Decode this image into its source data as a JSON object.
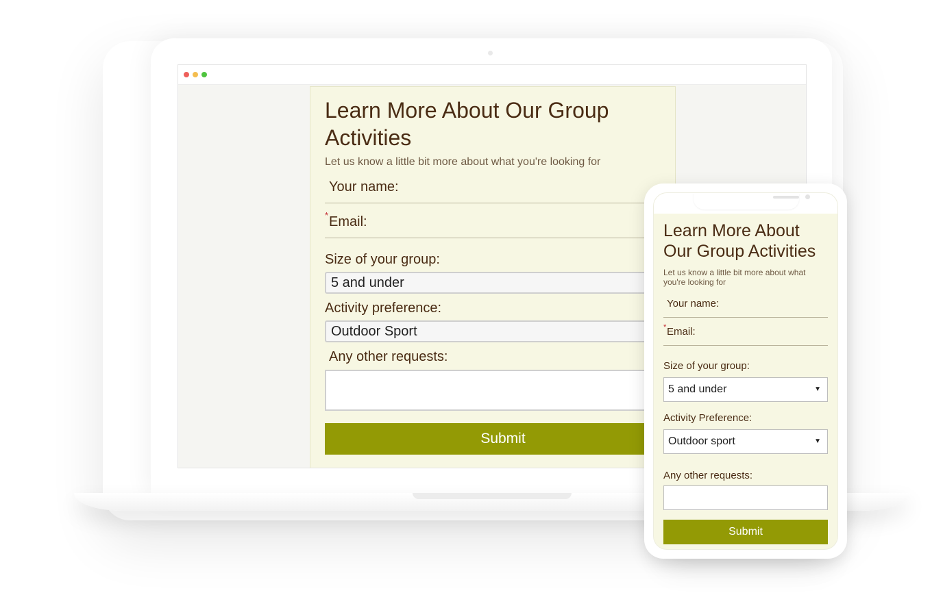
{
  "desktop": {
    "form": {
      "title": "Learn More About Our Group Activities",
      "subtitle": "Let us know a little bit more about what you're looking for",
      "name_label": "Your name:",
      "email_required_mark": "*",
      "email_label": "Email:",
      "group_size_label": "Size of your group:",
      "group_size_value": "5 and under",
      "activity_label": "Activity preference:",
      "activity_value": "Outdoor Sport",
      "requests_label": "Any other requests:",
      "requests_value": "",
      "submit_label": "Submit"
    }
  },
  "mobile": {
    "form": {
      "title": "Learn More About Our Group Activities",
      "subtitle": "Let us know a little bit more about what you're looking for",
      "name_label": "Your name:",
      "email_required_mark": "*",
      "email_label": "Email:",
      "group_size_label": "Size of your group:",
      "group_size_value": "5 and under",
      "activity_label": "Activity Preference:",
      "activity_value": "Outdoor sport",
      "dropdown_arrow": "▼",
      "requests_label": "Any other requests:",
      "requests_value": "",
      "submit_label": "Submit"
    }
  },
  "colors": {
    "form_background": "#f7f7e3",
    "text_brown": "#4a2c14",
    "submit_olive": "#939a05",
    "required_red": "#c2262d"
  }
}
